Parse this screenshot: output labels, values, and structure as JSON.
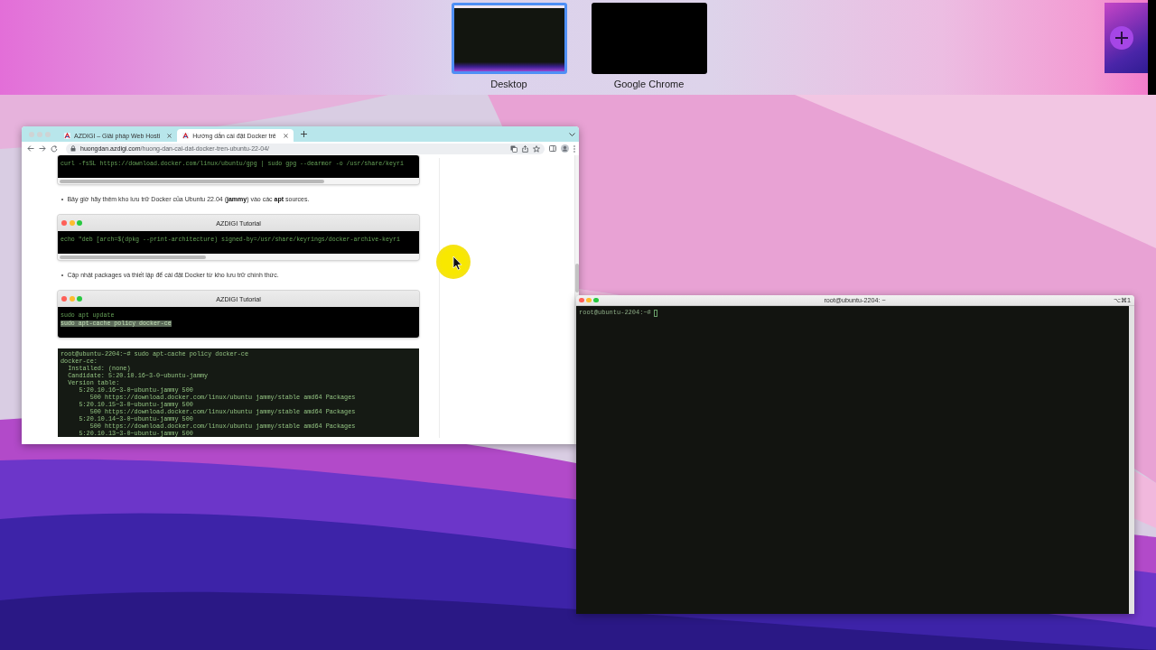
{
  "spaces_bar": {
    "spaces": [
      {
        "kind": "desktop",
        "label": "Desktop",
        "selected": true
      },
      {
        "kind": "app",
        "label": "Google Chrome",
        "selected": false
      }
    ]
  },
  "browser": {
    "tabs": [
      {
        "title": "AZDIGI – Giải pháp Web Hosti",
        "selected": false
      },
      {
        "title": "Hướng dẫn cài đặt Docker trê",
        "selected": true
      }
    ],
    "url": "**huongdan.azdigi.com**/huong-dan-cai-dat-docker-tren-ubuntu-22-04/",
    "page": [
      {
        "kind": "code",
        "lines": [
          {
            "text": "curl -fsSL https://download.docker.com/linux/ubuntu/gpg | sudo gpg --dearmor -o /usr/share/keyri",
            "selected": false
          }
        ]
      },
      {
        "kind": "bullet",
        "text": "Bây giờ hãy thêm kho lưu trữ Docker của Ubuntu 22.04 (**jammy**) vào các **apt** sources."
      },
      {
        "kind": "code",
        "title": "AZDIGI Tutorial",
        "lines": [
          {
            "text": "echo \"deb [arch=$(dpkg --print-architecture) signed-by=/usr/share/keyrings/docker-archive-keyri",
            "selected": false
          }
        ]
      },
      {
        "kind": "bullet",
        "text": "Cập nhật packages và thiết lập để cài đặt Docker từ kho lưu trữ chính thức."
      },
      {
        "kind": "code",
        "title": "AZDIGI Tutorial",
        "lines": [
          {
            "text": "sudo apt update",
            "selected": false
          },
          {
            "text": "sudo apt-cache policy docker-ce",
            "selected": true
          }
        ]
      },
      {
        "kind": "screenshot",
        "lines": [
          "root@ubuntu-2204:~# sudo apt-cache policy docker-ce",
          "docker-ce:",
          "  Installed: (none)",
          "  Candidate: 5:20.10.16~3-0~ubuntu-jammy",
          "  Version table:",
          "     5:20.10.16~3-0~ubuntu-jammy 500",
          "        500 https://download.docker.com/linux/ubuntu jammy/stable amd64 Packages",
          "     5:20.10.15~3-0~ubuntu-jammy 500",
          "        500 https://download.docker.com/linux/ubuntu jammy/stable amd64 Packages",
          "     5:20.10.14~3-0~ubuntu-jammy 500",
          "        500 https://download.docker.com/linux/ubuntu jammy/stable amd64 Packages",
          "     5:20.10.13~3-0~ubuntu-jammy 500"
        ]
      }
    ]
  },
  "terminal": {
    "title": "root@ubuntu-2204: ~",
    "shortcut": "⌥⌘1",
    "prompt": "root@ubuntu-2204:~#"
  }
}
